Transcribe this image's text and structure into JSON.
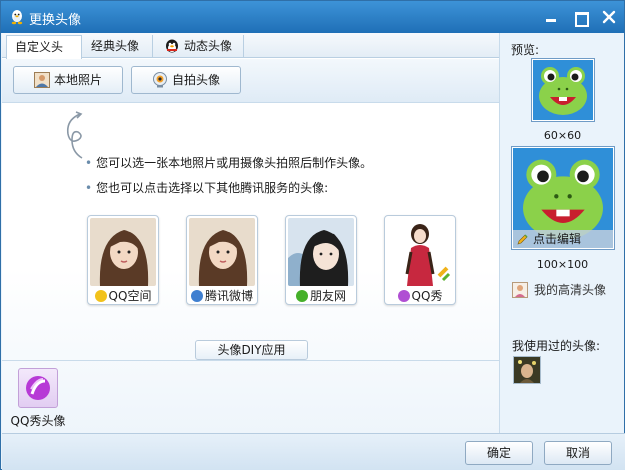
{
  "window": {
    "title": "更换头像"
  },
  "tabs": [
    {
      "label": "自定义头像",
      "active": true
    },
    {
      "label": "经典头像",
      "active": false
    },
    {
      "label": "动态头像",
      "active": false
    }
  ],
  "toolbar": {
    "local_photo": "本地照片",
    "selfie_avatar": "自拍头像"
  },
  "tips": [
    "您可以选一张本地照片或用摄像头拍照后制作头像。",
    "您也可以点击选择以下其他腾讯服务的头像:"
  ],
  "services": [
    {
      "label": "QQ空间",
      "icon": "qzone-star-icon"
    },
    {
      "label": "腾讯微博",
      "icon": "weibo-icon"
    },
    {
      "label": "朋友网",
      "icon": "pengyou-clover-icon"
    },
    {
      "label": "QQ秀",
      "icon": "qqshow-icon"
    }
  ],
  "diy": {
    "label": "头像DIY应用"
  },
  "apps": [
    {
      "label": "QQ秀头像"
    }
  ],
  "preview": {
    "label": "预览:",
    "size_small": "60×60",
    "size_large": "100×100",
    "edit_label": "点击编辑",
    "hd_link": "我的高清头像",
    "used_label": "我使用过的头像:"
  },
  "buttons": {
    "ok": "确定",
    "cancel": "取消"
  },
  "colors": {
    "titlebar": "#2a7fc7",
    "frog": "#8bd14a",
    "preview_bg": "#2f8fd8"
  }
}
